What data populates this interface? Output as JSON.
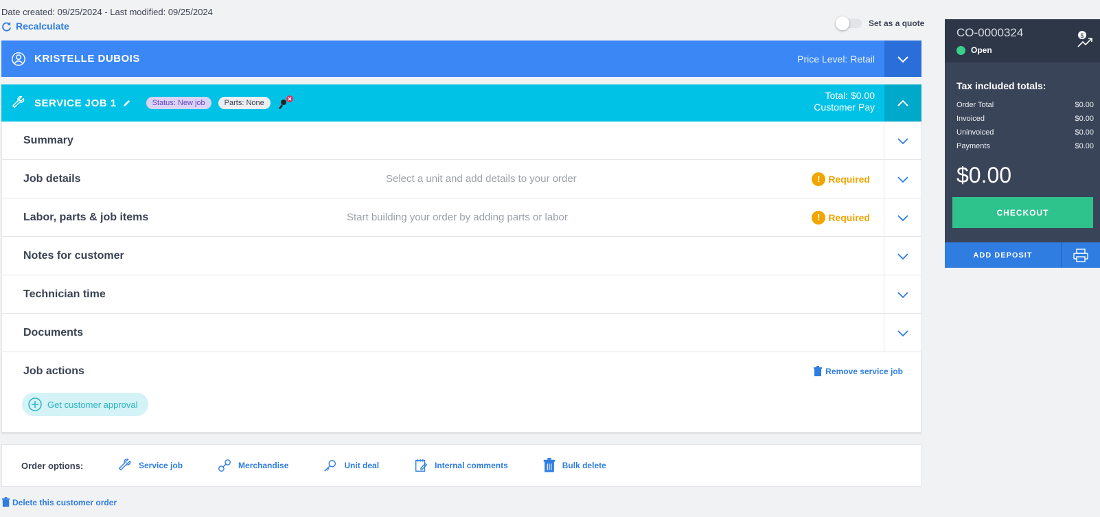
{
  "header": {
    "meta": "Date created: 09/25/2024 - Last modified: 09/25/2024",
    "recalculate": "Recalculate",
    "quote_label": "Set as a quote"
  },
  "customer": {
    "name": "KRISTELLE DUBOIS",
    "price_level": "Price Level: Retail"
  },
  "job": {
    "title": "SERVICE JOB 1",
    "status": "Status: New job",
    "parts": "Parts: None",
    "total": "Total: $0.00",
    "pay_type": "Customer Pay"
  },
  "sections": [
    {
      "label": "Summary"
    },
    {
      "label": "Job details",
      "hint": "Select a unit and add details to your order",
      "required": "Required"
    },
    {
      "label": "Labor, parts & job items",
      "hint": "Start building your order by adding parts or labor",
      "required": "Required"
    },
    {
      "label": "Notes for customer"
    },
    {
      "label": "Technician time"
    },
    {
      "label": "Documents"
    }
  ],
  "job_actions": {
    "label": "Job actions",
    "remove": "Remove service job",
    "approval": "Get customer approval"
  },
  "order_options": {
    "label": "Order options:",
    "items": [
      "Service job",
      "Merchandise",
      "Unit deal",
      "Internal comments",
      "Bulk delete"
    ]
  },
  "delete_order": "Delete this customer order",
  "panel": {
    "order_number": "CO-0000324",
    "status": "Open",
    "totals_title": "Tax included totals:",
    "lines": [
      {
        "label": "Order Total",
        "value": "$0.00"
      },
      {
        "label": "Invoiced",
        "value": "$0.00"
      },
      {
        "label": "Uninvoiced",
        "value": "$0.00"
      },
      {
        "label": "Payments",
        "value": "$0.00"
      }
    ],
    "grand_total": "$0.00",
    "checkout": "CHECKOUT",
    "add_deposit": "ADD DEPOSIT"
  },
  "colors": {
    "customer_bar": "#3b87f5",
    "job_bar": "#00c2e6",
    "required": "#f0a500",
    "link": "#2f7de1",
    "checkout": "#2ec28c",
    "panel_dark": "#2d3748"
  }
}
